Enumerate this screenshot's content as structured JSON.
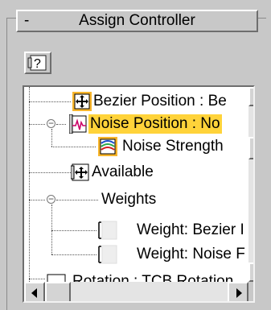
{
  "rollout": {
    "toggle": "-",
    "title": "Assign Controller"
  },
  "toolbar": {
    "help_label": "?",
    "help_icon": "help-question-icon"
  },
  "tree": {
    "items": [
      {
        "label": "Bezier Position : Be",
        "icon": "bezier-position-icon",
        "selected": false
      },
      {
        "label": "Noise Position : No",
        "icon": "noise-position-icon",
        "selected": true
      },
      {
        "label": "Noise Strength",
        "icon": "noise-strength-icon",
        "selected": false
      },
      {
        "label": "Available",
        "icon": "available-icon",
        "selected": false
      },
      {
        "label": "Weights",
        "icon": "",
        "selected": false
      },
      {
        "label": "Weight: Bezier I",
        "icon": "weight-icon",
        "selected": false
      },
      {
        "label": "Weight: Noise F",
        "icon": "weight-icon",
        "selected": false
      },
      {
        "label": "Rotation : TCB Rotation",
        "icon": "rotation-icon",
        "selected": false
      }
    ]
  },
  "colors": {
    "selection": "#ffd33a",
    "panel": "#c8c8c8",
    "tree_background": "#ffffff"
  }
}
